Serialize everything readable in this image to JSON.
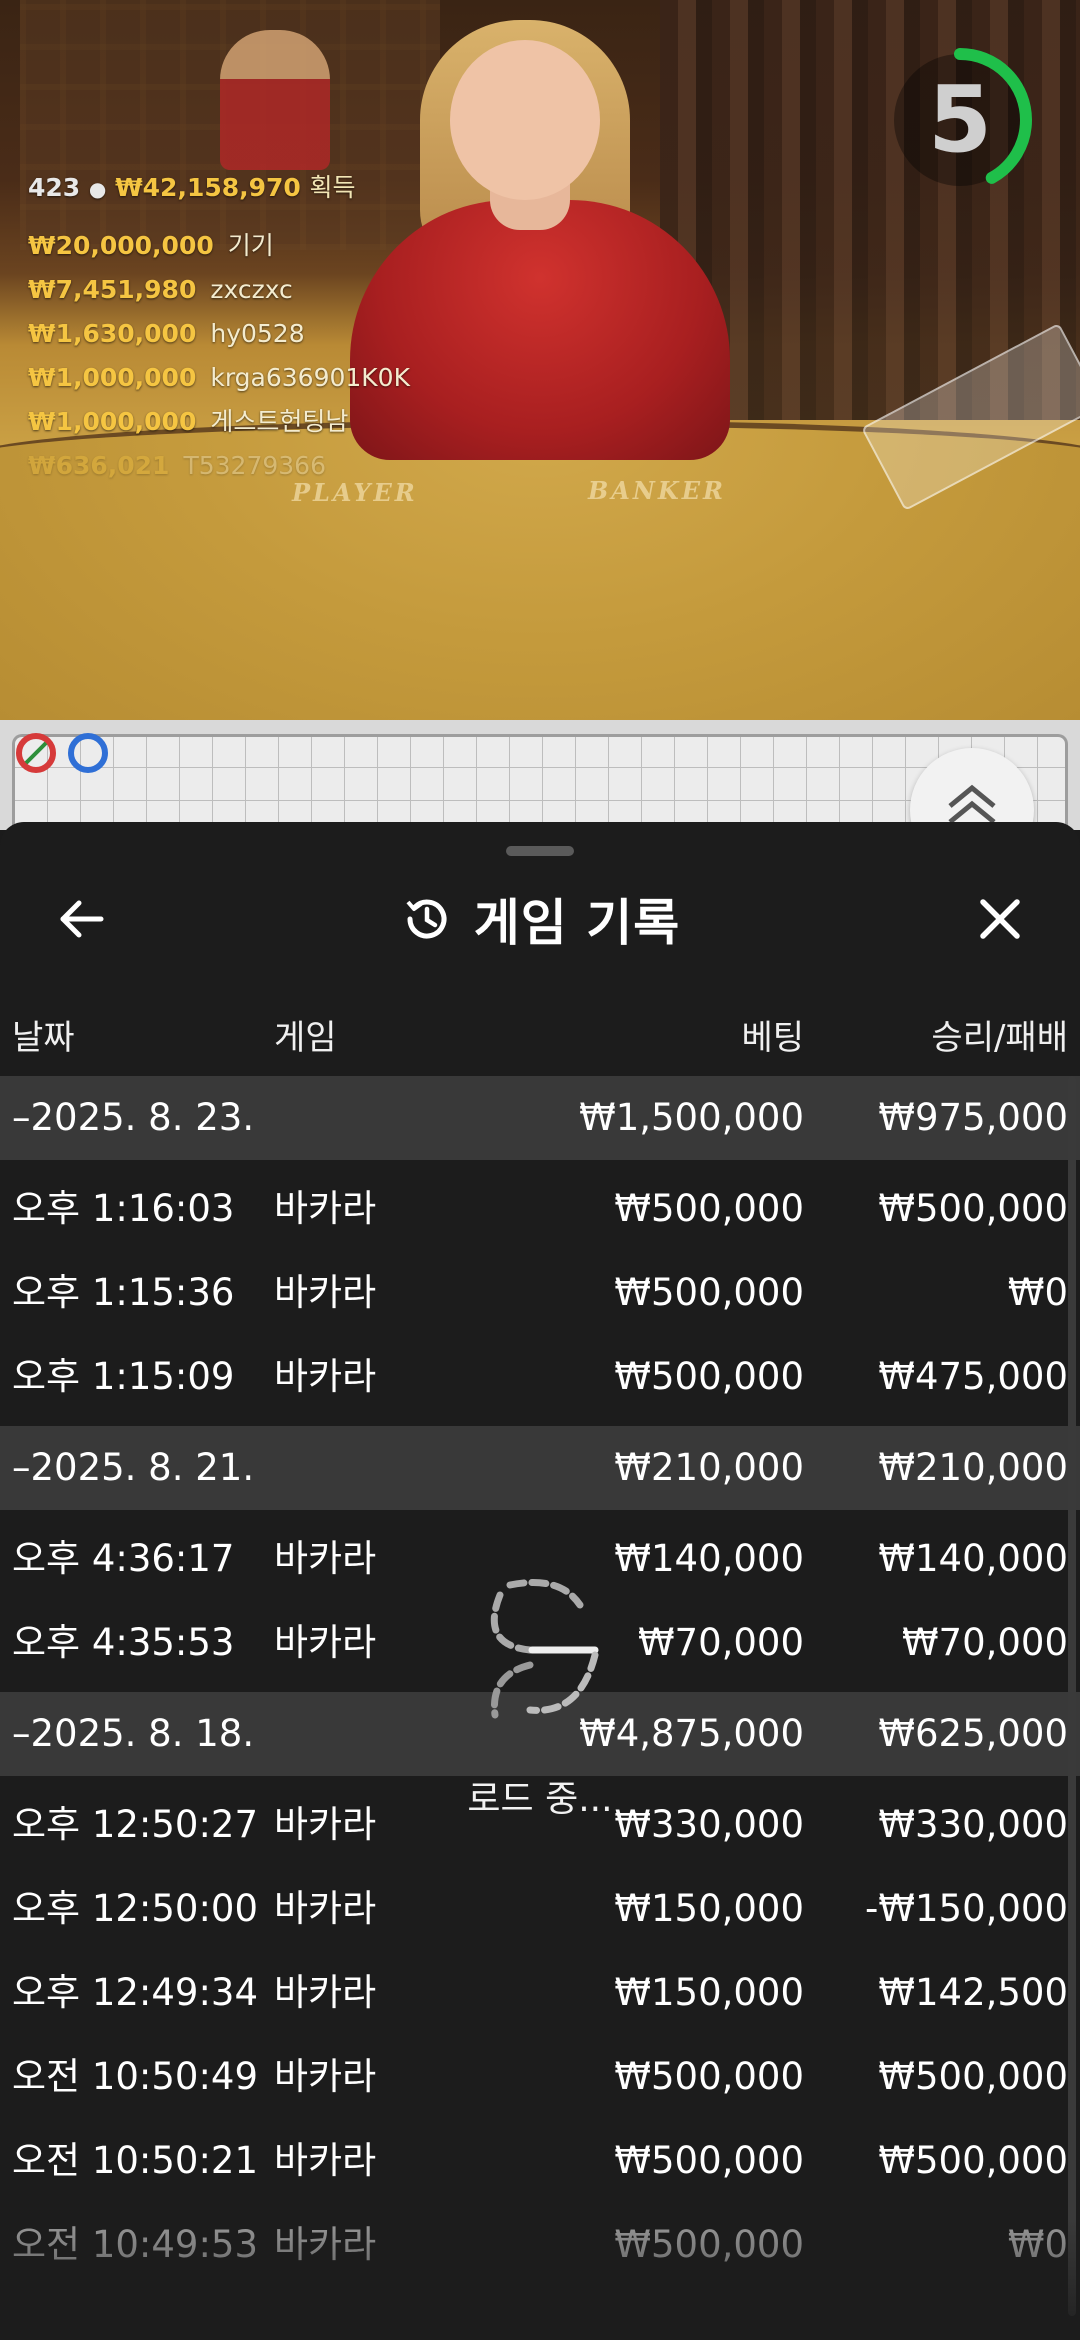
{
  "video": {
    "players_count": "423",
    "prize_total": "₩42,158,970",
    "prize_label": "획득",
    "winners": [
      {
        "amount": "₩20,000,000",
        "name": "기기"
      },
      {
        "amount": "₩7,451,980",
        "name": "zxczxc"
      },
      {
        "amount": "₩1,630,000",
        "name": "hy0528"
      },
      {
        "amount": "₩1,000,000",
        "name": "krga636901K0K"
      },
      {
        "amount": "₩1,000,000",
        "name": "게스트헌팅남"
      },
      {
        "amount": "₩636,021",
        "name": "T53279366"
      }
    ],
    "felt_player": "PLAYER",
    "felt_banker": "BANKER",
    "timer_value": "5",
    "timer_fraction": 0.42,
    "timer_color": "#1fbf4a"
  },
  "sheet": {
    "title": "게임 기록",
    "history_icon": "history-icon",
    "back_icon": "arrow-left-icon",
    "close_icon": "close-icon",
    "columns": {
      "date": "날짜",
      "game": "게임",
      "bet": "베팅",
      "result": "승리/패배"
    },
    "groups": [
      {
        "date": "–2025. 8. 23.",
        "bet": "₩1,500,000",
        "result": "₩975,000",
        "rows": [
          {
            "time": "오후 1:16:03",
            "game": "바카라",
            "bet": "₩500,000",
            "result": "₩500,000"
          },
          {
            "time": "오후 1:15:36",
            "game": "바카라",
            "bet": "₩500,000",
            "result": "₩0"
          },
          {
            "time": "오후 1:15:09",
            "game": "바카라",
            "bet": "₩500,000",
            "result": "₩475,000"
          }
        ]
      },
      {
        "date": "–2025. 8. 21.",
        "bet": "₩210,000",
        "result": "₩210,000",
        "rows": [
          {
            "time": "오후 4:36:17",
            "game": "바카라",
            "bet": "₩140,000",
            "result": "₩140,000"
          },
          {
            "time": "오후 4:35:53",
            "game": "바카라",
            "bet": "₩70,000",
            "result": "₩70,000"
          }
        ]
      },
      {
        "date": "–2025. 8. 18.",
        "bet": "₩4,875,000",
        "result": "₩625,000",
        "rows": [
          {
            "time": "오후 12:50:27",
            "game": "바카라",
            "bet": "₩330,000",
            "result": "₩330,000"
          },
          {
            "time": "오후 12:50:00",
            "game": "바카라",
            "bet": "₩150,000",
            "result": "-₩150,000"
          },
          {
            "time": "오후 12:49:34",
            "game": "바카라",
            "bet": "₩150,000",
            "result": "₩142,500"
          },
          {
            "time": "오전 10:50:49",
            "game": "바카라",
            "bet": "₩500,000",
            "result": "₩500,000"
          },
          {
            "time": "오전 10:50:21",
            "game": "바카라",
            "bet": "₩500,000",
            "result": "₩500,000"
          },
          {
            "time": "오전 10:49:53",
            "game": "바카라",
            "bet": "₩500,000",
            "result": "₩0"
          }
        ]
      }
    ],
    "loading_text": "로드 중..."
  }
}
